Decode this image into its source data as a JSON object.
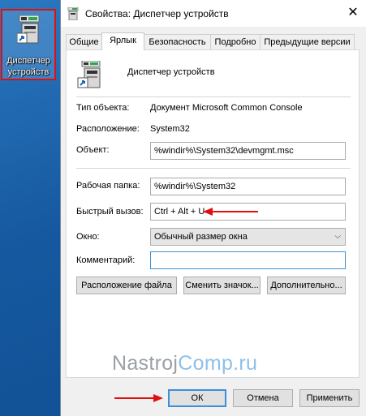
{
  "desktop": {
    "icon_label_line1": "Диспетчер",
    "icon_label_line2": "устройств"
  },
  "window": {
    "title": "Свойства: Диспетчер устройств",
    "close_glyph": "✕"
  },
  "tabs": [
    {
      "label": "Общие"
    },
    {
      "label": "Ярлык"
    },
    {
      "label": "Безопасность"
    },
    {
      "label": "Подробно"
    },
    {
      "label": "Предыдущие версии"
    }
  ],
  "shortcut": {
    "name": "Диспетчер устройств",
    "type_label": "Тип объекта:",
    "type_value": "Документ Microsoft Common Console",
    "location_label": "Расположение:",
    "location_value": "System32",
    "target_label": "Объект:",
    "target_value": "%windir%\\System32\\devmgmt.msc",
    "startin_label": "Рабочая папка:",
    "startin_value": "%windir%\\System32",
    "hotkey_label": "Быстрый вызов:",
    "hotkey_value": "Ctrl + Alt + U",
    "run_label": "Окно:",
    "run_value": "Обычный размер окна",
    "comment_label": "Комментарий:",
    "comment_value": ""
  },
  "buttons": {
    "open_location": "Расположение файла",
    "change_icon": "Сменить значок...",
    "advanced": "Дополнительно..."
  },
  "footer": {
    "ok": "ОК",
    "cancel": "Отмена",
    "apply": "Применить"
  },
  "watermark": {
    "part1": "Nastroj",
    "part2": "Comp.ru"
  },
  "colors": {
    "highlight_red": "#e01010",
    "focus_blue": "#3c8fd8"
  }
}
